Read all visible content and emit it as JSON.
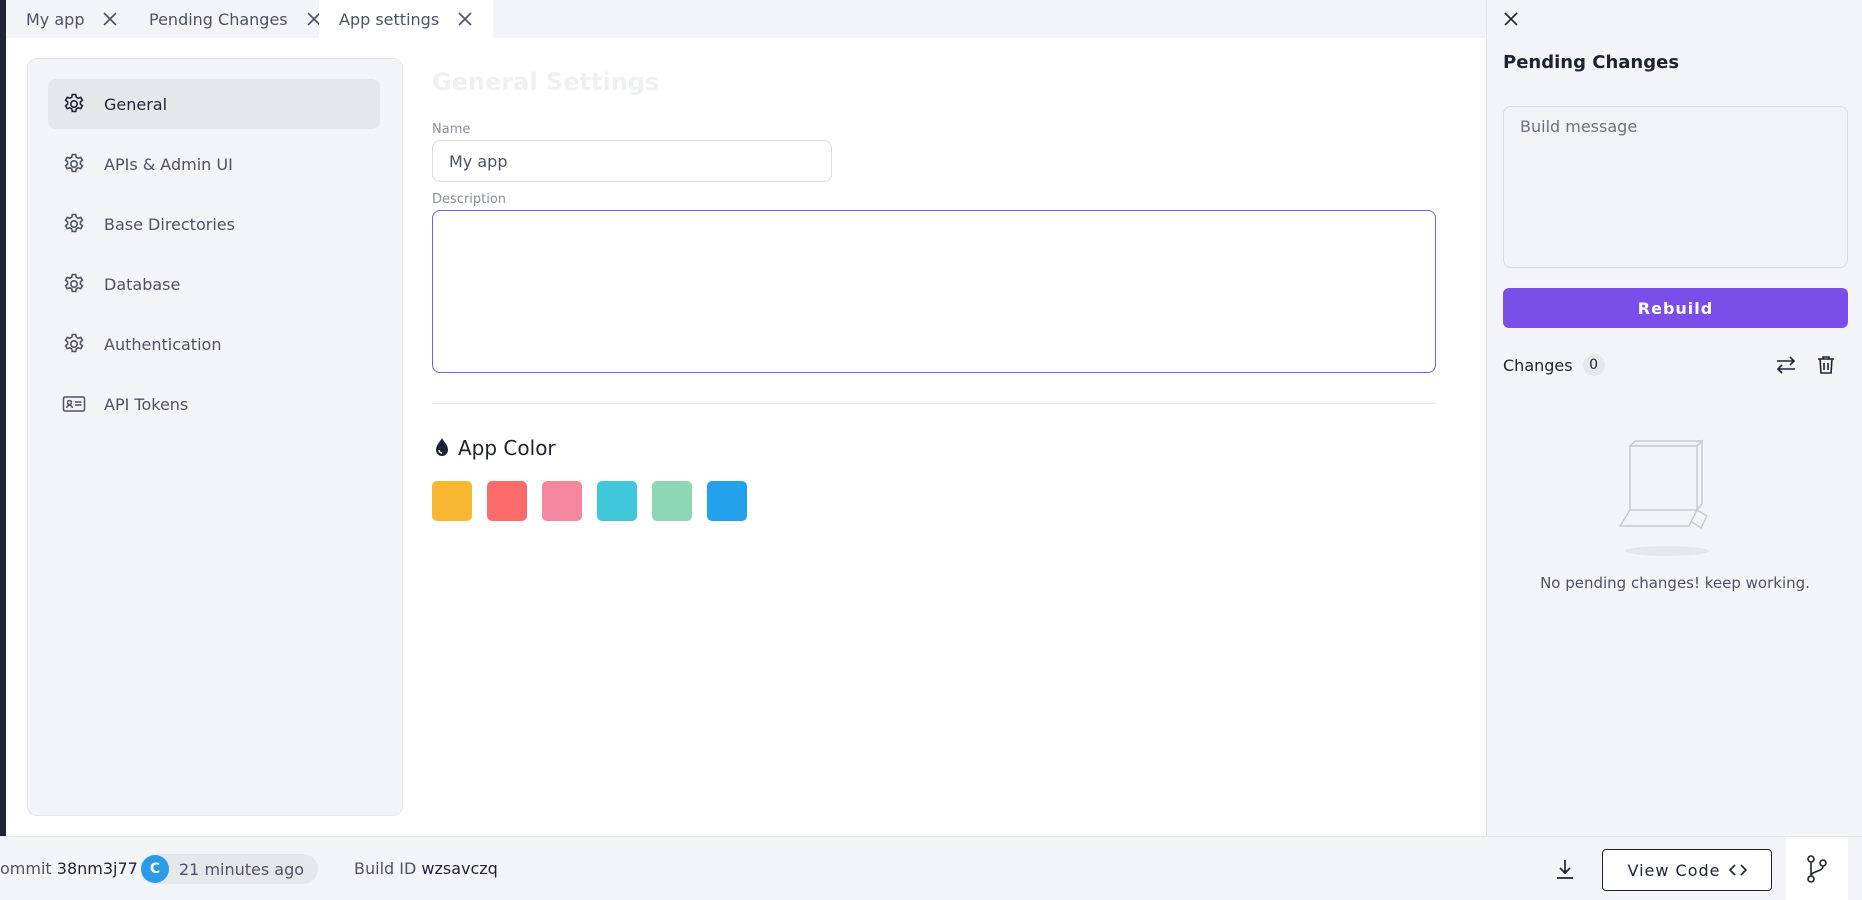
{
  "tabs": [
    {
      "label": "My app"
    },
    {
      "label": "Pending Changes"
    },
    {
      "label": "App settings"
    }
  ],
  "sidebar": {
    "items": [
      {
        "label": "General",
        "icon": "gear-icon",
        "active": true
      },
      {
        "label": "APIs & Admin UI",
        "icon": "gear-icon"
      },
      {
        "label": "Base Directories",
        "icon": "gear-icon"
      },
      {
        "label": "Database",
        "icon": "gear-icon"
      },
      {
        "label": "Authentication",
        "icon": "gear-icon"
      },
      {
        "label": "API Tokens",
        "icon": "id-card-icon"
      }
    ]
  },
  "main": {
    "title": "General Settings",
    "name_label": "Name",
    "name_value": "My app",
    "description_label": "Description",
    "description_value": "",
    "app_color_heading": "App Color",
    "colors": [
      "#f7b731",
      "#fd6c6a",
      "#f5869f",
      "#40c8da",
      "#8dd7b6",
      "#24a1ec"
    ]
  },
  "pending": {
    "title": "Pending Changes",
    "build_message_placeholder": "Build message",
    "rebuild_label": "Rebuild",
    "changes_label": "Changes",
    "changes_count": "0",
    "empty_text": "No pending changes! keep working."
  },
  "footer": {
    "commit_label": "ommit",
    "commit_id": "38nm3j77",
    "avatar_initial": "C",
    "time_ago": "21 minutes ago",
    "build_id_label": "Build ID",
    "build_id": "wzsavczq",
    "view_code_label": "View Code"
  },
  "theme": {
    "accent": "#7a4ee8",
    "avatar": "#2a9be8"
  }
}
